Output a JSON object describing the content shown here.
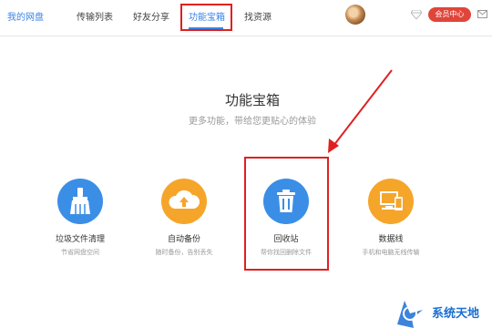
{
  "nav": {
    "items": [
      {
        "label": "我的网盘"
      },
      {
        "label": "传输列表"
      },
      {
        "label": "好友分享"
      },
      {
        "label": "功能宝箱"
      },
      {
        "label": "找资源"
      }
    ],
    "active_index": 3,
    "vip_label": "会员中心"
  },
  "main": {
    "title": "功能宝箱",
    "subtitle": "更多功能，带给您更贴心的体验"
  },
  "tools": [
    {
      "name": "垃圾文件清理",
      "desc": "节省网盘空间",
      "icon": "broom-icon",
      "color": "#3b8ee6"
    },
    {
      "name": "自动备份",
      "desc": "随时备份，告别丢失",
      "icon": "cloud-upload-icon",
      "color": "#f5a52a"
    },
    {
      "name": "回收站",
      "desc": "帮你找回删除文件",
      "icon": "trash-icon",
      "color": "#3b8ee6"
    },
    {
      "name": "数据线",
      "desc": "手机和电脑无线传输",
      "icon": "devices-icon",
      "color": "#f5a52a"
    }
  ],
  "watermark": {
    "text": "系统天地"
  },
  "colors": {
    "accent": "#3b82e6",
    "highlight": "#e02020",
    "vip": "#e0453a"
  }
}
